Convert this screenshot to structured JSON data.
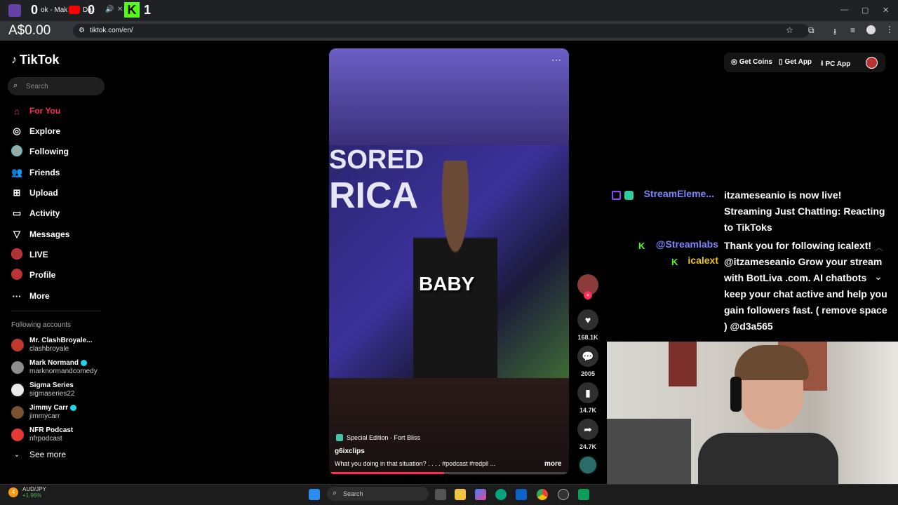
{
  "browser": {
    "tab_title": "ok - Mak",
    "tab_title2": "Da",
    "overlay_balance": "A$0.00",
    "overlay_counts": [
      "0",
      "0",
      "1"
    ],
    "url": "tiktok.com/en/"
  },
  "logo": "TikTok",
  "search": {
    "placeholder": "Search"
  },
  "nav": [
    {
      "label": "For You",
      "icon": "home-icon"
    },
    {
      "label": "Explore",
      "icon": "compass-icon"
    },
    {
      "label": "Following",
      "icon": "following-icon"
    },
    {
      "label": "Friends",
      "icon": "friends-icon"
    },
    {
      "label": "Upload",
      "icon": "upload-icon"
    },
    {
      "label": "Activity",
      "icon": "activity-icon"
    },
    {
      "label": "Messages",
      "icon": "messages-icon"
    },
    {
      "label": "LIVE",
      "icon": "live-icon"
    },
    {
      "label": "Profile",
      "icon": "profile-icon"
    },
    {
      "label": "More",
      "icon": "more-icon"
    }
  ],
  "following_header": "Following accounts",
  "following": [
    {
      "name": "Mr. ClashBroyale...",
      "handle": "clashbroyale",
      "verified": false,
      "color": "#c0392b"
    },
    {
      "name": "Mark Normand",
      "handle": "marknormandcomedy",
      "verified": true,
      "color": "#8e8e8e"
    },
    {
      "name": "Sigma Series",
      "handle": "sigmaseries22",
      "verified": false,
      "color": "#eaeaea"
    },
    {
      "name": "Jimmy Carr",
      "handle": "jimmycarr",
      "verified": true,
      "color": "#7a5230"
    },
    {
      "name": "NFR Podcast",
      "handle": "nfrpodcast",
      "verified": false,
      "color": "#e53935"
    }
  ],
  "see_more": "See more",
  "top_buttons": {
    "get_coins": "Get Coins",
    "get_app": "Get App",
    "pc_app": "PC App"
  },
  "video": {
    "caption_word": "BABY",
    "banner_text": "SORED",
    "banner_text2": "RICA",
    "tag": "Special Edition · Fort Bliss",
    "author": "g6ixclips",
    "description": "What you doing in that situation? . . . . #podcast  #redpil  ...",
    "more": "more"
  },
  "actions": {
    "likes": "168.1K",
    "comments": "2005",
    "saves": "14.7K",
    "shares": "24.7K"
  },
  "chat": [
    {
      "name": "StreamEleme...",
      "name_color": "#7c86ff",
      "lines": [
        "itzameseanio is now live!",
        "Streaming Just Chatting: Reacting",
        "to TikToks"
      ]
    },
    {
      "name": "@Streamlabs",
      "name_color": "#7c86ff",
      "lines": [
        "Thank you for following icalext!"
      ]
    },
    {
      "name": "icalext",
      "name_color": "#f1c40f",
      "lines": [
        "@itzameseanio Grow your stream",
        "with BotLiva .com. AI chatbots",
        "keep your chat active and help you",
        "gain followers fast. ( remove space",
        ") @d3a565"
      ]
    }
  ],
  "ticker": {
    "pair": "AUD/JPY",
    "change": "+1.96%",
    "badge": "4"
  },
  "taskbar": {
    "search": "Search"
  }
}
